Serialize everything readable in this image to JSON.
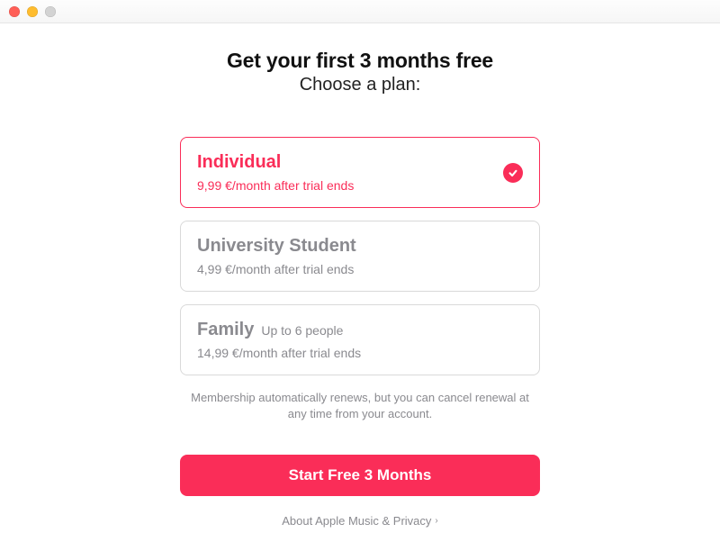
{
  "accent_color": "#fa2d58",
  "heading": "Get your first 3 months free",
  "subheading": "Choose a plan:",
  "plans": [
    {
      "title": "Individual",
      "subtitle": "",
      "note": "9,99 €/month after trial ends",
      "selected": true
    },
    {
      "title": "University Student",
      "subtitle": "",
      "note": "4,99 €/month after trial ends",
      "selected": false
    },
    {
      "title": "Family",
      "subtitle": "Up to 6 people",
      "note": "14,99 €/month after trial ends",
      "selected": false
    }
  ],
  "renewal_note": "Membership automatically renews, but you can cancel renewal at any time from your account.",
  "cta_label": "Start Free 3 Months",
  "privacy_label": "About Apple Music & Privacy",
  "privacy_chevron": "›"
}
